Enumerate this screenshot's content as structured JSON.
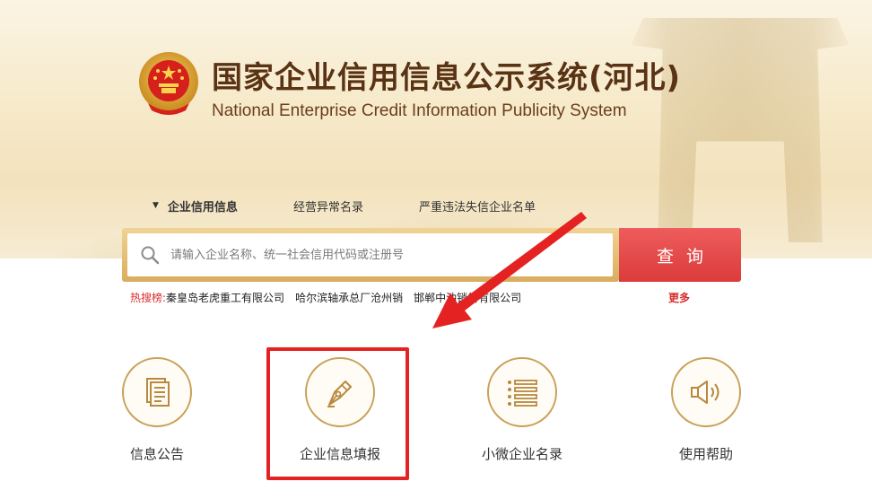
{
  "header": {
    "title_cn": "国家企业信用信息公示系统(河北)",
    "title_en": "National Enterprise Credit Information Publicity System"
  },
  "search": {
    "tabs": [
      {
        "label": "企业信用信息",
        "active": true
      },
      {
        "label": "经营异常名录",
        "active": false
      },
      {
        "label": "严重违法失信企业名单",
        "active": false
      }
    ],
    "placeholder": "请输入企业名称、统一社会信用代码或注册号",
    "button_label": "查询"
  },
  "hot_search": {
    "label": "热搜榜:",
    "items": [
      "秦皇岛老虎重工有限公司",
      "哈尔滨轴承总厂沧州销",
      "邯郸中油销售有限公司"
    ],
    "more_label": "更多"
  },
  "features": [
    {
      "label": "信息公告",
      "icon": "document-icon"
    },
    {
      "label": "企业信息填报",
      "icon": "pen-nib-icon",
      "highlighted": true
    },
    {
      "label": "小微企业名录",
      "icon": "list-icon"
    },
    {
      "label": "使用帮助",
      "icon": "speaker-icon"
    }
  ],
  "colors": {
    "brand_brown": "#5a3214",
    "gold": "#c9a15a",
    "search_red": "#e04545",
    "hot_red": "#d72c2c",
    "annotation_red": "#e52222"
  }
}
